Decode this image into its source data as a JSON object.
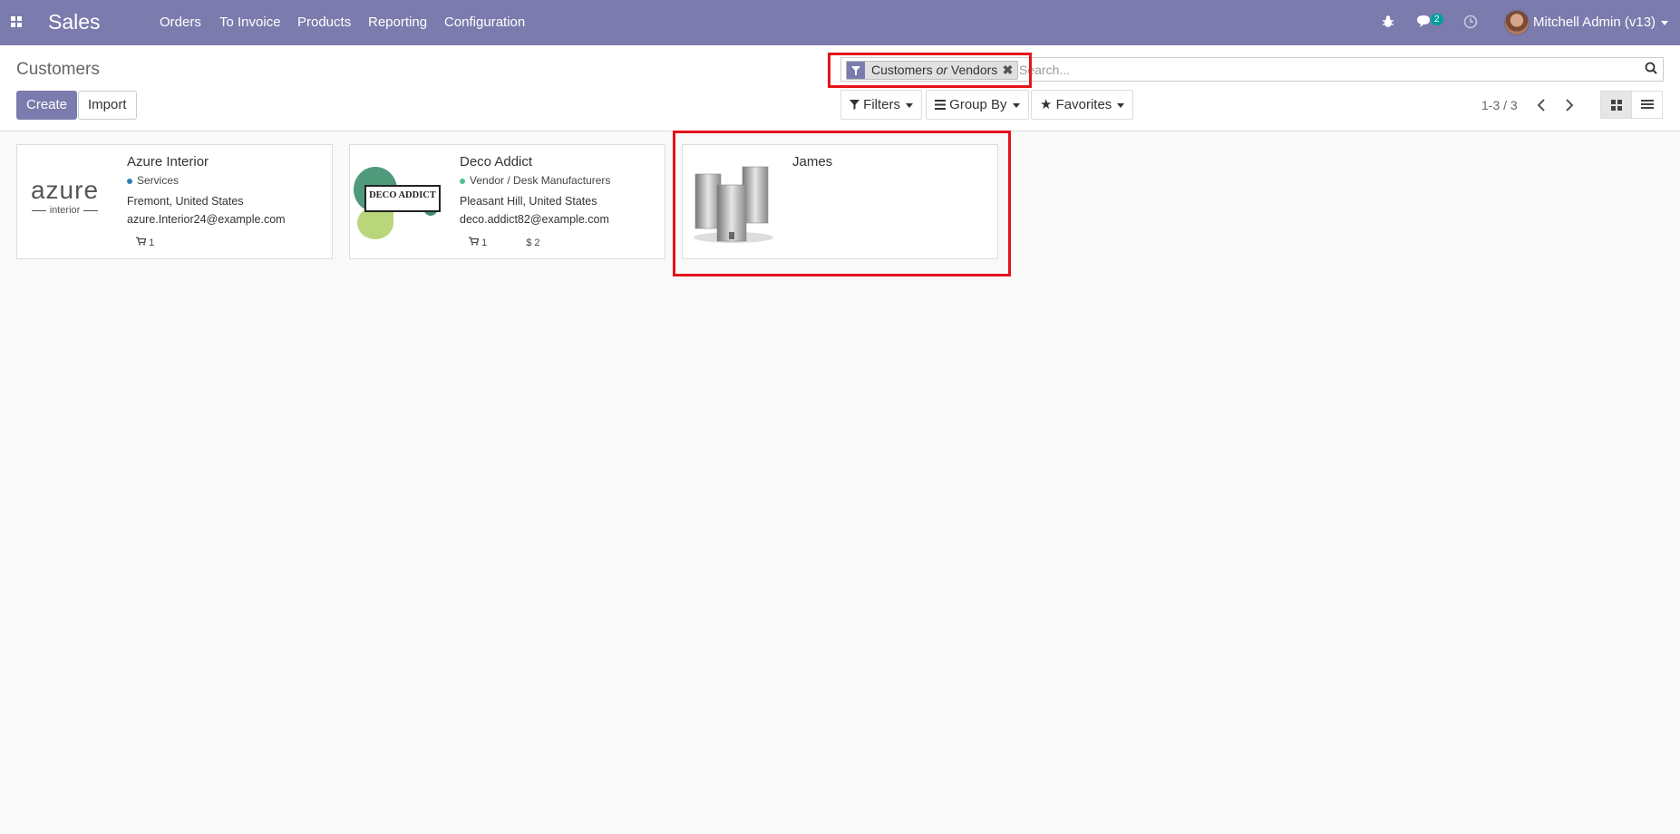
{
  "navbar": {
    "brand": "Sales",
    "menu": [
      "Orders",
      "To Invoice",
      "Products",
      "Reporting",
      "Configuration"
    ],
    "messages_count": "2",
    "user": "Mitchell Admin (v13)"
  },
  "control_panel": {
    "title": "Customers",
    "create_label": "Create",
    "import_label": "Import",
    "search": {
      "facet_text": "Customers or Vendors",
      "placeholder": "Search..."
    },
    "filters_label": "Filters",
    "groupby_label": "Group By",
    "favorites_label": "Favorites",
    "pager": "1-3 / 3"
  },
  "cards": [
    {
      "name": "Azure Interior",
      "tag": "Services",
      "location": "Fremont, United States",
      "email": "azure.Interior24@example.com",
      "sales": "1",
      "logo_main": "azure",
      "logo_sub": "interior"
    },
    {
      "name": "Deco Addict",
      "tag": "Vendor / Desk Manufacturers",
      "location": "Pleasant Hill, United States",
      "email": "deco.addict82@example.com",
      "sales": "1",
      "invoices": "$ 2",
      "logo_text": "DECO ADDICT"
    },
    {
      "name": "James"
    }
  ],
  "colors": {
    "brand": "#7c7bad",
    "highlight": "#e4141b",
    "tag_services": "#2c80b4",
    "tag_vendor": "#4fc28f"
  }
}
